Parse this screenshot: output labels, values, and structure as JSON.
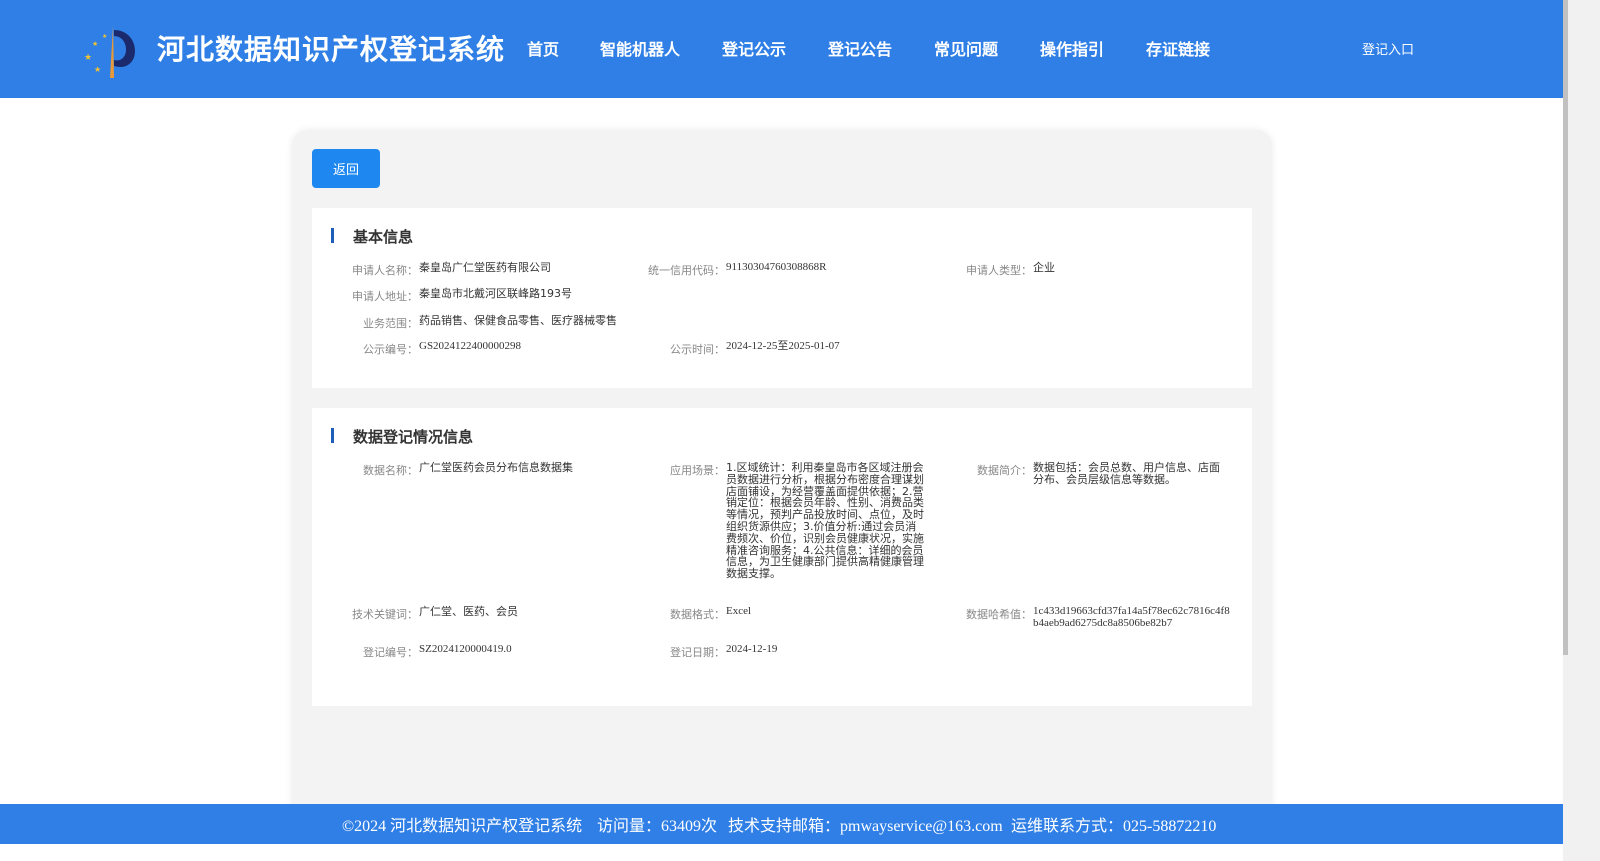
{
  "header": {
    "site_title": "河北数据知识产权登记系统",
    "nav": [
      "首页",
      "智能机器人",
      "登记公示",
      "登记公告",
      "常见问题",
      "操作指引",
      "存证链接"
    ],
    "login": "登记入口"
  },
  "actions": {
    "back": "返回"
  },
  "basic_info": {
    "title": "基本信息",
    "applicant_name_label": "申请人名称：",
    "applicant_name": "秦皇岛广仁堂医药有限公司",
    "credit_code_label": "统一信用代码：",
    "credit_code": "91130304760308868R",
    "applicant_type_label": "申请人类型：",
    "applicant_type": "企业",
    "address_label": "申请人地址：",
    "address": "秦皇岛市北戴河区联峰路193号",
    "business_scope_label": "业务范围：",
    "business_scope": "药品销售、保健食品零售、医疗器械零售",
    "notice_no_label": "公示编号：",
    "notice_no": "GS2024122400000298",
    "notice_time_label": "公示时间：",
    "notice_time": "2024-12-25至2025-01-07"
  },
  "registration_info": {
    "title": "数据登记情况信息",
    "data_name_label": "数据名称：",
    "data_name": "广仁堂医药会员分布信息数据集",
    "application_label": "应用场景：",
    "application": "1.区域统计：利用秦皇岛市各区域注册会员数据进行分析，根据分布密度合理谋划店面铺设，为经营覆盖面提供依据；2.营销定位：根据会员年龄、性别、消费品类等情况，预判产品投放时间、点位，及时组织货源供应；3.价值分析:通过会员消费频次、价位，识别会员健康状况，实施精准咨询服务；4.公共信息：详细的会员信息，为卫生健康部门提供高精健康管理数据支撑。",
    "summary_label": "数据简介：",
    "summary": "数据包括：会员总数、用户信息、店面分布、会员层级信息等数据。",
    "keywords_label": "技术关键词：",
    "keywords": "广仁堂、医药、会员",
    "format_label": "数据格式：",
    "format": "Excel",
    "hash_label": "数据哈希值：",
    "hash": "1c433d19663cfd37fa14a5f78ec62c7816c4f8b4aeb9ad6275dc8a8506be82b7",
    "reg_no_label": "登记编号：",
    "reg_no": "SZ2024120000419.0",
    "reg_date_label": "登记日期：",
    "reg_date": "2024-12-19"
  },
  "footer": {
    "copyright": "©2024 河北数据知识产权登记系统",
    "visits": "访问量：63409次",
    "email": "技术支持邮箱：pmwayservice@163.com",
    "phone": "运维联系方式：025-58872210"
  },
  "colors": {
    "header_bg": "#2f7fe6",
    "button": "#1e88f0",
    "section_bar": "#1d5fb8"
  }
}
